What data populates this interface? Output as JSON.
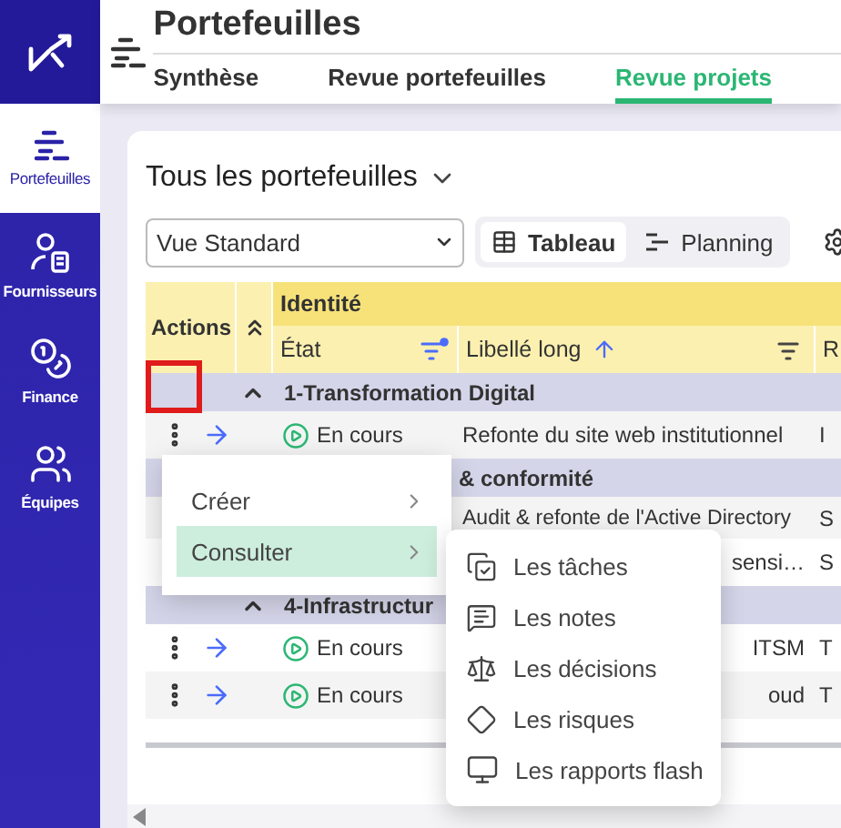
{
  "sidebar": {
    "items": [
      {
        "label": "Portefeuilles",
        "selected": true
      },
      {
        "label": "Fournisseurs",
        "selected": false
      },
      {
        "label": "Finance",
        "selected": false
      },
      {
        "label": "Équipes",
        "selected": false
      }
    ]
  },
  "header": {
    "title": "Portefeuilles",
    "tabs": [
      {
        "label": "Synthèse",
        "selected": false
      },
      {
        "label": "Revue portefeuilles",
        "selected": false
      },
      {
        "label": "Revue projets",
        "selected": true
      }
    ]
  },
  "view_title": "Tous les portefeuilles",
  "view_select": {
    "value": "Vue Standard"
  },
  "view_modes": [
    {
      "label": "Tableau",
      "selected": true
    },
    {
      "label": "Planning",
      "selected": false
    }
  ],
  "table": {
    "actions_header": "Actions",
    "group_header": "Identité",
    "columns": [
      {
        "label": "État",
        "filter_active": true
      },
      {
        "label": "Libellé long",
        "sorted": true,
        "filter_active": false
      },
      {
        "label": "R"
      }
    ],
    "rows": [
      {
        "kind": "group",
        "label": "1-Transformation Digital",
        "expanded": true
      },
      {
        "kind": "row",
        "status": "En cours",
        "label": "Refonte du site web institutionnel",
        "column_3": "I"
      },
      {
        "kind": "group-tail",
        "label": "& conformité"
      },
      {
        "kind": "row-hidden-start",
        "label": "Audit & refonte de l'Active Directory",
        "column_3": "S"
      },
      {
        "kind": "row-tail",
        "label": "sensi…",
        "column_3": "S"
      },
      {
        "kind": "group",
        "label": "4-Infrastructur",
        "expanded": true
      },
      {
        "kind": "row-tail",
        "status": "En cours",
        "label": "ITSM",
        "column_3": "T"
      },
      {
        "kind": "row-tail",
        "status": "En cours",
        "label": "oud",
        "column_3": "T"
      }
    ]
  },
  "action_menu": {
    "items": [
      {
        "label": "Créer",
        "selected": false
      },
      {
        "label": "Consulter",
        "selected": true
      }
    ]
  },
  "submenu": {
    "items": [
      {
        "label": "Les tâches"
      },
      {
        "label": "Les notes"
      },
      {
        "label": "Les décisions"
      },
      {
        "label": "Les risques"
      },
      {
        "label": "Les rapports flash"
      }
    ]
  }
}
